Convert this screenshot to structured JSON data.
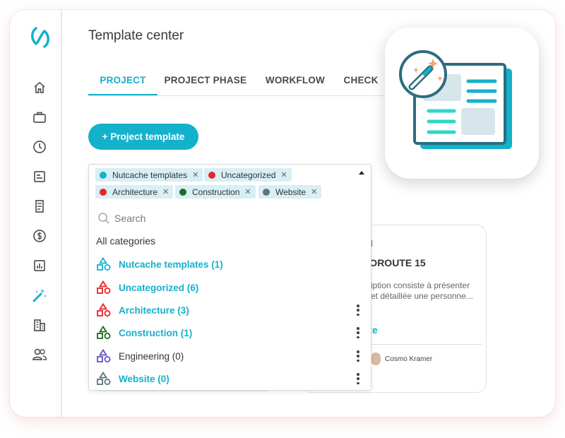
{
  "page": {
    "title": "Template center"
  },
  "tabs": [
    {
      "label": "PROJECT",
      "active": true
    },
    {
      "label": "PROJECT PHASE",
      "active": false
    },
    {
      "label": "WORKFLOW",
      "active": false
    },
    {
      "label": "CHECK",
      "active": false
    }
  ],
  "toolbar": {
    "add_label": "+ Project template"
  },
  "colors": {
    "accent": "#14b1cc",
    "nutcache": "#14b1cc",
    "uncategorized": "#e8232a",
    "architecture": "#e8232a",
    "construction": "#1f6b1f",
    "engineering": "#6a4fc7",
    "website": "#5b7580"
  },
  "filter": {
    "chips": [
      {
        "label": "Nutcache templates",
        "color": "#14b1cc"
      },
      {
        "label": "Uncategorized",
        "color": "#e8232a"
      },
      {
        "label": "Architecture",
        "color": "#e8232a"
      },
      {
        "label": "Construction",
        "color": "#1f6b1f"
      },
      {
        "label": "Website",
        "color": "#5b7580"
      }
    ],
    "search_placeholder": "Search",
    "all_label": "All categories",
    "categories": [
      {
        "label": "Nutcache templates (1)",
        "color": "#14b1cc"
      },
      {
        "label": "Uncategorized (6)",
        "color": "#e8232a"
      },
      {
        "label": "Architecture (3)",
        "color": "#e8232a"
      },
      {
        "label": "Construction (1)",
        "color": "#1f6b1f"
      },
      {
        "label": "Engineering (0)",
        "color": "#6a4fc7"
      },
      {
        "label": "Website (0)",
        "color": "#5b7580"
      }
    ]
  },
  "background_card": {
    "status": "ed",
    "title": "TOROUTE 15",
    "desc_line1": "cription consiste à présenter",
    "desc_line2": "e et détaillée une personne...",
    "link": "ate",
    "author": "Cosmo Kramer"
  },
  "sidebar": {
    "items": [
      {
        "icon": "home-icon"
      },
      {
        "icon": "briefcase-icon"
      },
      {
        "icon": "clock-icon"
      },
      {
        "icon": "timesheet-icon"
      },
      {
        "icon": "invoice-icon"
      },
      {
        "icon": "dollar-icon"
      },
      {
        "icon": "report-chart-icon"
      },
      {
        "icon": "magic-wand-icon",
        "active": true
      },
      {
        "icon": "building-icon"
      },
      {
        "icon": "users-icon"
      }
    ]
  }
}
